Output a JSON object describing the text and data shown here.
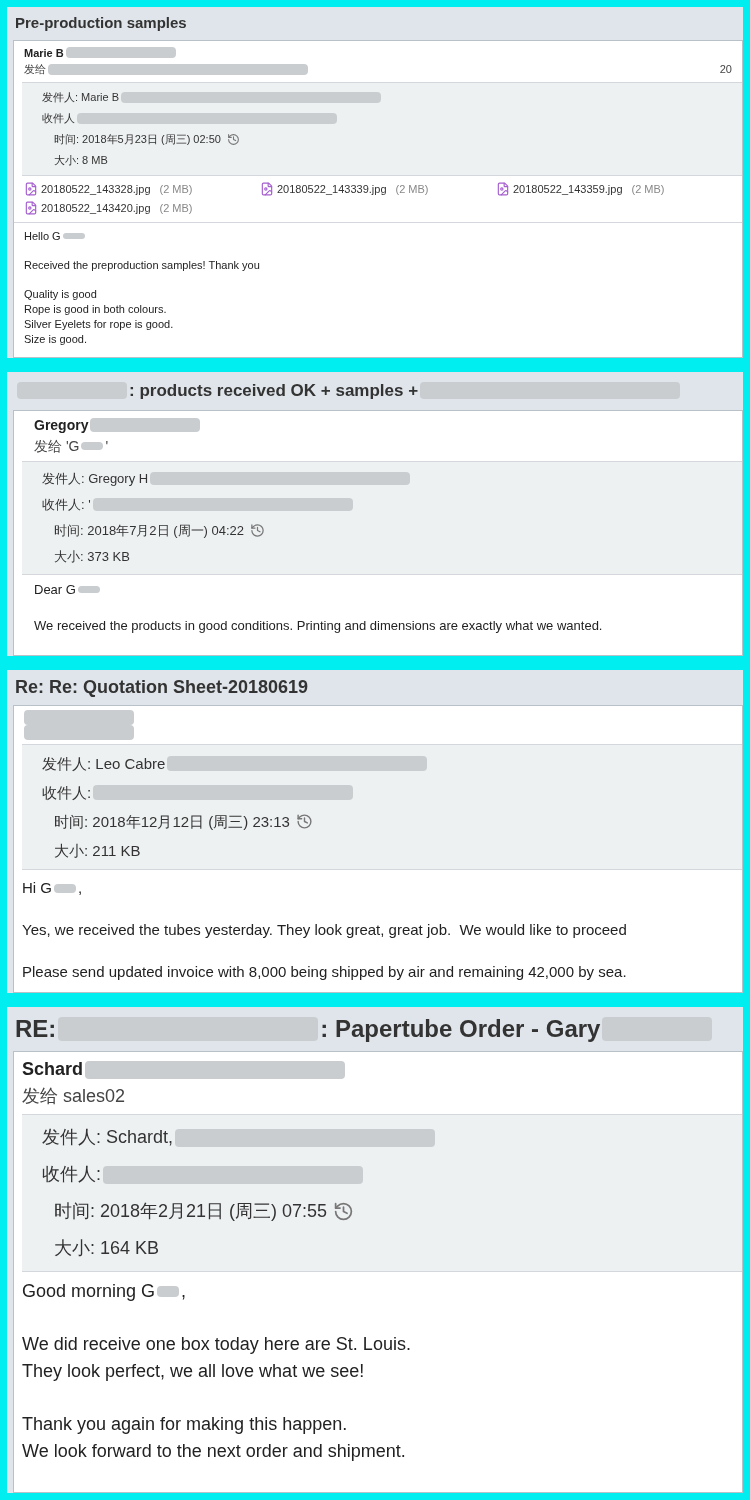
{
  "emails": [
    {
      "subject": [
        {
          "kind": "text",
          "text": "Pre-production samples"
        }
      ],
      "sender": [
        {
          "kind": "text",
          "text": "Marie B"
        },
        {
          "kind": "short"
        }
      ],
      "recipients": [
        {
          "kind": "text",
          "text": "发给"
        },
        {
          "kind": "long"
        }
      ],
      "date_edge": "20",
      "header": {
        "from": [
          {
            "kind": "text",
            "text": "发件人: Marie B"
          },
          {
            "kind": "long"
          }
        ],
        "to": [
          {
            "kind": "text",
            "text": "收件人"
          },
          {
            "kind": "long"
          }
        ],
        "time": "时间: 2018年5月23日 (周三) 02:50",
        "size": "大小: 8 MB"
      },
      "attachments": [
        {
          "name": "20180522_143328.jpg",
          "size": "(2 MB)"
        },
        {
          "name": "20180522_143339.jpg",
          "size": "(2 MB)"
        },
        {
          "name": "20180522_143359.jpg",
          "size": "(2 MB)"
        },
        {
          "name": "20180522_143420.jpg",
          "size": "(2 MB)"
        }
      ],
      "body": [
        [
          [
            {
              "kind": "text",
              "text": "Hello G"
            },
            {
              "kind": "tiny"
            }
          ]
        ],
        [
          [
            "Received the preproduction samples! Thank you"
          ]
        ],
        [
          [
            "Quality is good"
          ],
          [
            "Rope is good in both colours."
          ],
          [
            "Silver Eyelets for rope is good."
          ],
          [
            "Size is good."
          ]
        ]
      ]
    },
    {
      "subject": [
        {
          "kind": "short"
        },
        {
          "kind": "text",
          "text": ": products received OK + samples +"
        },
        {
          "kind": "long"
        }
      ],
      "sender": [
        {
          "kind": "text",
          "text": "Gregory"
        },
        {
          "kind": "short"
        }
      ],
      "recipients": [
        {
          "kind": "text",
          "text": "发给 'G"
        },
        {
          "kind": "tiny"
        },
        {
          "kind": "text",
          "text": "'"
        }
      ],
      "header": {
        "from": [
          {
            "kind": "text",
            "text": "发件人: Gregory H"
          },
          {
            "kind": "long"
          }
        ],
        "to": [
          {
            "kind": "text",
            "text": "收件人: '"
          },
          {
            "kind": "long"
          }
        ],
        "time": "时间: 2018年7月2日 (周一) 04:22",
        "size": "大小: 373 KB"
      },
      "body": [
        [
          [
            {
              "kind": "text",
              "text": "Dear G"
            },
            {
              "kind": "tiny"
            }
          ]
        ],
        [
          [
            "We received the products in good conditions. Printing and dimensions are exactly what we wanted."
          ]
        ]
      ]
    },
    {
      "subject": [
        {
          "kind": "text",
          "text": "Re: Re: Quotation Sheet-20180619"
        }
      ],
      "sender": [
        {
          "kind": "short"
        }
      ],
      "recipients": [
        {
          "kind": "short"
        }
      ],
      "header": {
        "from": [
          {
            "kind": "text",
            "text": "发件人: Leo Cabre"
          },
          {
            "kind": "long"
          }
        ],
        "to": [
          {
            "kind": "text",
            "text": "收件人:"
          },
          {
            "kind": "long"
          }
        ],
        "time": "时间: 2018年12月12日 (周三) 23:13",
        "size": "大小: 211 KB"
      },
      "body": [
        [
          [
            {
              "kind": "text",
              "text": "Hi G"
            },
            {
              "kind": "tiny"
            },
            {
              "kind": "text",
              "text": ","
            }
          ]
        ],
        [
          [
            "Yes, we received the tubes yesterday. They look great, great job.  We would like to proceed"
          ]
        ],
        [
          [
            "Please send updated invoice with 8,000 being shipped by air and remaining 42,000 by sea."
          ]
        ]
      ]
    },
    {
      "subject": [
        {
          "kind": "text",
          "text": "RE:"
        },
        {
          "kind": "long"
        },
        {
          "kind": "text",
          "text": ": Papertube Order - Gary"
        },
        {
          "kind": "short"
        }
      ],
      "sender": [
        {
          "kind": "text",
          "text": "Schard"
        },
        {
          "kind": "long"
        }
      ],
      "recipients": [
        {
          "kind": "text",
          "text": "发给 sales02"
        }
      ],
      "header": {
        "from": [
          {
            "kind": "text",
            "text": "发件人: Schardt,"
          },
          {
            "kind": "long"
          }
        ],
        "to": [
          {
            "kind": "text",
            "text": "收件人:"
          },
          {
            "kind": "long"
          }
        ],
        "time": "时间: 2018年2月21日 (周三) 07:55",
        "size": "大小: 164 KB"
      },
      "body": [
        [
          [
            {
              "kind": "text",
              "text": "Good morning G"
            },
            {
              "kind": "tiny"
            },
            {
              "kind": "text",
              "text": ","
            }
          ]
        ],
        [
          [
            "We did receive one box today here are St. Louis."
          ],
          [
            "They look perfect, we all love what we see!"
          ]
        ],
        [
          [
            "Thank you again for making this happen."
          ],
          [
            "We look forward to the next order and shipment."
          ]
        ]
      ]
    }
  ]
}
